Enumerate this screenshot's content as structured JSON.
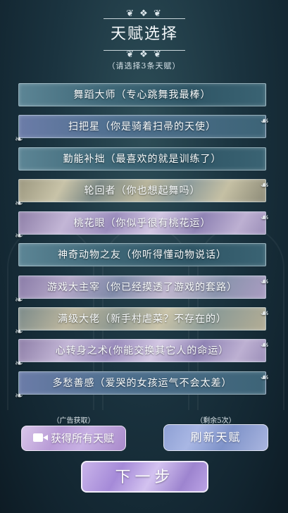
{
  "header": {
    "title": "天赋选择",
    "subtitle": "（请选择3条天赋）"
  },
  "talents": [
    {
      "label": "舞蹈大师（专心跳舞我最棒）",
      "style": "t-blue"
    },
    {
      "label": "扫把星（你是骑着扫帚的天使）",
      "style": "t-blue2"
    },
    {
      "label": "勤能补拙（最喜欢的就是训练了）",
      "style": "t-blue"
    },
    {
      "label": "轮回者（你也想起舞吗）",
      "style": "t-gold"
    },
    {
      "label": "桃花眼（你似乎很有桃花运）",
      "style": "t-purple"
    },
    {
      "label": "神奇动物之友（你听得懂动物说话）",
      "style": "t-blue"
    },
    {
      "label": "游戏大主宰（你已经摸透了游戏的套路）",
      "style": "t-mixed"
    },
    {
      "label": "满级大佬（新手村虐菜？不存在的）",
      "style": "t-gold2"
    },
    {
      "label": "心转身之术(你能交换其它人的命运）",
      "style": "t-purple"
    },
    {
      "label": "多愁善感（爱哭的女孩运气不会太差）",
      "style": "t-blue2"
    }
  ],
  "ad_section": {
    "label": "（广告获取）",
    "button": "获得所有天赋"
  },
  "refresh_section": {
    "label": "（剩余5次）",
    "button": "刷新天赋"
  },
  "next_button": "下一步",
  "icons": {
    "ornament": "scroll-flourish",
    "ad": "video-camera-icon"
  },
  "colors": {
    "background": "#1b3440",
    "accent_purple": "#b89bd6",
    "accent_blue": "#8ea0d4"
  }
}
